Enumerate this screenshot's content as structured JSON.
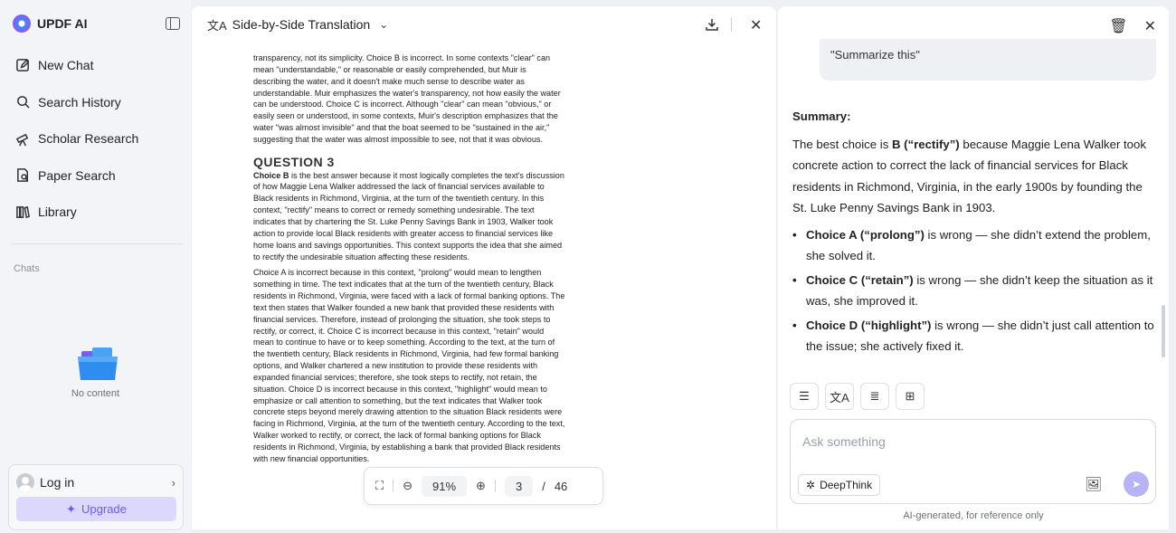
{
  "sidebar": {
    "brand": "UPDF AI",
    "items": [
      {
        "label": "New Chat",
        "icon": "edit-icon"
      },
      {
        "label": "Search History",
        "icon": "search-icon"
      },
      {
        "label": "Scholar Research",
        "icon": "telescope-icon"
      },
      {
        "label": "Paper Search",
        "icon": "paper-search-icon"
      },
      {
        "label": "Library",
        "icon": "library-icon"
      }
    ],
    "chats_label": "Chats",
    "empty_text": "No content",
    "login_label": "Log in",
    "upgrade_label": "Upgrade"
  },
  "doc": {
    "title": "Side-by-Side Translation",
    "paragraphs_top": "transparency, not its simplicity. Choice B is incorrect. In some contexts \"clear\" can mean \"understandable,\" or reasonable or easily comprehended, but Muir is describing the water, and it doesn't make much sense to describe water as understandable. Muir emphasizes the water's transparency, not how easily the water can be understood. Choice C is incorrect. Although \"clear\" can mean \"obvious,\" or easily seen or understood, in some contexts, Muir's description emphasizes that the water \"was almost invisible\" and that the boat seemed to be \"sustained in the air,\" suggesting that the water was almost impossible to see, not that it was obvious.",
    "question_heading": "QUESTION 3",
    "para_b_lead": "Choice B",
    "para_b": " is the best answer because it most logically completes the text's discussion of how Maggie Lena Walker addressed the lack of financial services available to Black residents in Richmond, Virginia, at the turn of the twentieth century. In this context, \"rectify\" means to correct or remedy something undesirable. The text indicates that by chartering the St. Luke Penny Savings Bank in 1903, Walker took action to provide local Black residents with greater access to financial services like home loans and savings opportunities. This context supports the idea that she aimed to rectify the undesirable situation affecting these residents.",
    "para_a": "Choice A is incorrect because in this context, \"prolong\" would mean to lengthen something in time. The text indicates that at the turn of the twentieth century, Black residents in Richmond, Virginia, were faced with a lack of formal banking options. The text then states that Walker founded a new bank that provided these residents with financial services. Therefore, instead of prolonging the situation, she took steps to rectify, or correct, it. Choice C is incorrect because in this context, \"retain\" would mean to continue to have or to keep something. According to the text, at the turn of the twentieth century, Black residents in Richmond, Virginia, had few formal banking options, and Walker chartered a new institution to provide these residents with expanded financial services; therefore, she took steps to rectify, not retain, the situation. Choice D is incorrect because in this context, \"highlight\" would mean to emphasize or call attention to something, but the text indicates that Walker took concrete steps beyond merely drawing attention to the situation Black residents were facing in Richmond, Virginia, at the turn of the twentieth century. According to the text, Walker worked to rectify, or correct, the lack of formal banking options for Black residents in Richmond, Virginia, by establishing a bank that provided Black residents with new financial opportunities.",
    "toolbar": {
      "zoom": "91%",
      "page": "3",
      "separator": "/",
      "total": "46"
    }
  },
  "chat": {
    "user_message": "\"Summarize this\"",
    "summary_heading": "Summary:",
    "summary_intro_1": "The best choice is ",
    "summary_intro_bold": "B (“rectify”)",
    "summary_intro_2": " because Maggie Lena Walker took concrete action to correct the lack of financial services for Black residents in Richmond, Virginia, in the early 1900s by founding the St. Luke Penny Savings Bank in 1903.",
    "bullets": [
      {
        "bold": "Choice A (“prolong”)",
        "text": " is wrong — she didn’t extend the problem, she solved it."
      },
      {
        "bold": "Choice C (“retain”)",
        "text": " is wrong — she didn’t keep the situation as it was, she improved it."
      },
      {
        "bold": "Choice D (“highlight”)",
        "text": " is wrong — she didn’t just call attention to the issue; she actively fixed it."
      }
    ],
    "input_placeholder": "Ask something",
    "deepthink_label": "DeepThink",
    "disclaimer": "AI-generated, for reference only"
  },
  "colors": {
    "accent": "#6b5cf0",
    "upgrade_bg": "#dcd8fb",
    "send_bg": "#b8b2f6"
  }
}
